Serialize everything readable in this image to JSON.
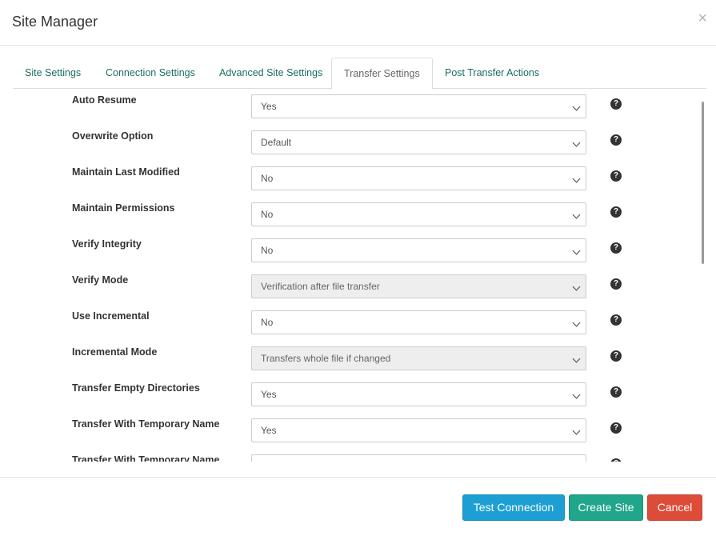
{
  "dialog": {
    "title": "Site Manager",
    "close_glyph": "×"
  },
  "tabs": [
    {
      "label": "Site Settings",
      "active": false
    },
    {
      "label": "Connection Settings",
      "active": false
    },
    {
      "label": "Advanced Site Settings",
      "active": false
    },
    {
      "label": "Transfer Settings",
      "active": true
    },
    {
      "label": "Post Transfer Actions",
      "active": false
    }
  ],
  "settings": [
    {
      "label": "Auto Resume",
      "value": "Yes",
      "disabled": false
    },
    {
      "label": "Overwrite Option",
      "value": "Default",
      "disabled": false
    },
    {
      "label": "Maintain Last Modified",
      "value": "No",
      "disabled": false
    },
    {
      "label": "Maintain Permissions",
      "value": "No",
      "disabled": false
    },
    {
      "label": "Verify Integrity",
      "value": "No",
      "disabled": false
    },
    {
      "label": "Verify Mode",
      "value": "Verification after file transfer",
      "disabled": true
    },
    {
      "label": "Use Incremental",
      "value": "No",
      "disabled": false
    },
    {
      "label": "Incremental Mode",
      "value": "Transfers whole file if changed",
      "disabled": true
    },
    {
      "label": "Transfer Empty Directories",
      "value": "Yes",
      "disabled": false
    },
    {
      "label": "Transfer With Temporary Name",
      "value": "Yes",
      "disabled": false
    },
    {
      "label": "Transfer With Temporary Name",
      "value": "",
      "disabled": false
    }
  ],
  "help_glyph": "?",
  "footer": {
    "test_label": "Test Connection",
    "create_label": "Create Site",
    "cancel_label": "Cancel"
  },
  "colors": {
    "tab_link": "#1b6d62",
    "test_button": "#1e9fd4",
    "create_button": "#20a68a",
    "cancel_button": "#dd4b39"
  }
}
